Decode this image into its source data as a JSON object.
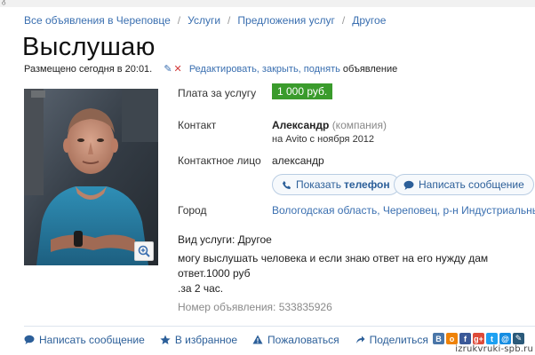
{
  "breadcrumb": {
    "items": [
      "Все объявления в Череповце",
      "Услуги",
      "Предложения услуг",
      "Другое"
    ]
  },
  "title": "Выслушаю",
  "meta": {
    "posted": "Размещено сегодня в 20:01.",
    "edit_link": "Редактировать, закрыть, поднять",
    "edit_suffix": "объявление"
  },
  "details": {
    "price_label": "Плата за услугу",
    "price_value": "1 000 руб.",
    "contact_label": "Контакт",
    "contact_name": "Александр",
    "contact_type": "(компания)",
    "contact_since": "на Avito с ноября 2012",
    "person_label": "Контактное лицо",
    "person_value": "александр",
    "city_label": "Город",
    "city_value": "Вологодская область, Череповец, р-н Индустриальный"
  },
  "buttons": {
    "phone_prefix": "Показать",
    "phone_bold": "телефон",
    "message": "Написать сообщение"
  },
  "service_type": "Вид услуги: Другое",
  "description_line1": "могу выслушать человека и если знаю ответ на его нужду дам ответ.1000 руб",
  "description_line2": ".за 2 час.",
  "ad_number": "Номер объявления: 533835926",
  "actions": {
    "message": "Написать сообщение",
    "favorite": "В избранное",
    "complain": "Пожаловаться",
    "share": "Поделиться"
  },
  "social_icons": [
    {
      "name": "vk-icon",
      "glyph": "B",
      "color": "#4a76a8"
    },
    {
      "name": "odnoklassniki-icon",
      "glyph": "o",
      "color": "#ee8208"
    },
    {
      "name": "facebook-icon",
      "glyph": "f",
      "color": "#3b5998"
    },
    {
      "name": "google-plus-icon",
      "glyph": "g+",
      "color": "#dd4b39"
    },
    {
      "name": "twitter-icon",
      "glyph": "t",
      "color": "#1da1f2"
    },
    {
      "name": "mail-icon",
      "glyph": "@",
      "color": "#168de2"
    },
    {
      "name": "livejournal-icon",
      "glyph": "✎",
      "color": "#2b5a7a"
    }
  ],
  "watermark": "izrukvruki-spb.ru",
  "colors": {
    "link": "#3a6fb0",
    "price_badge": "#3a9b2c",
    "button_border": "#b9cde3"
  }
}
